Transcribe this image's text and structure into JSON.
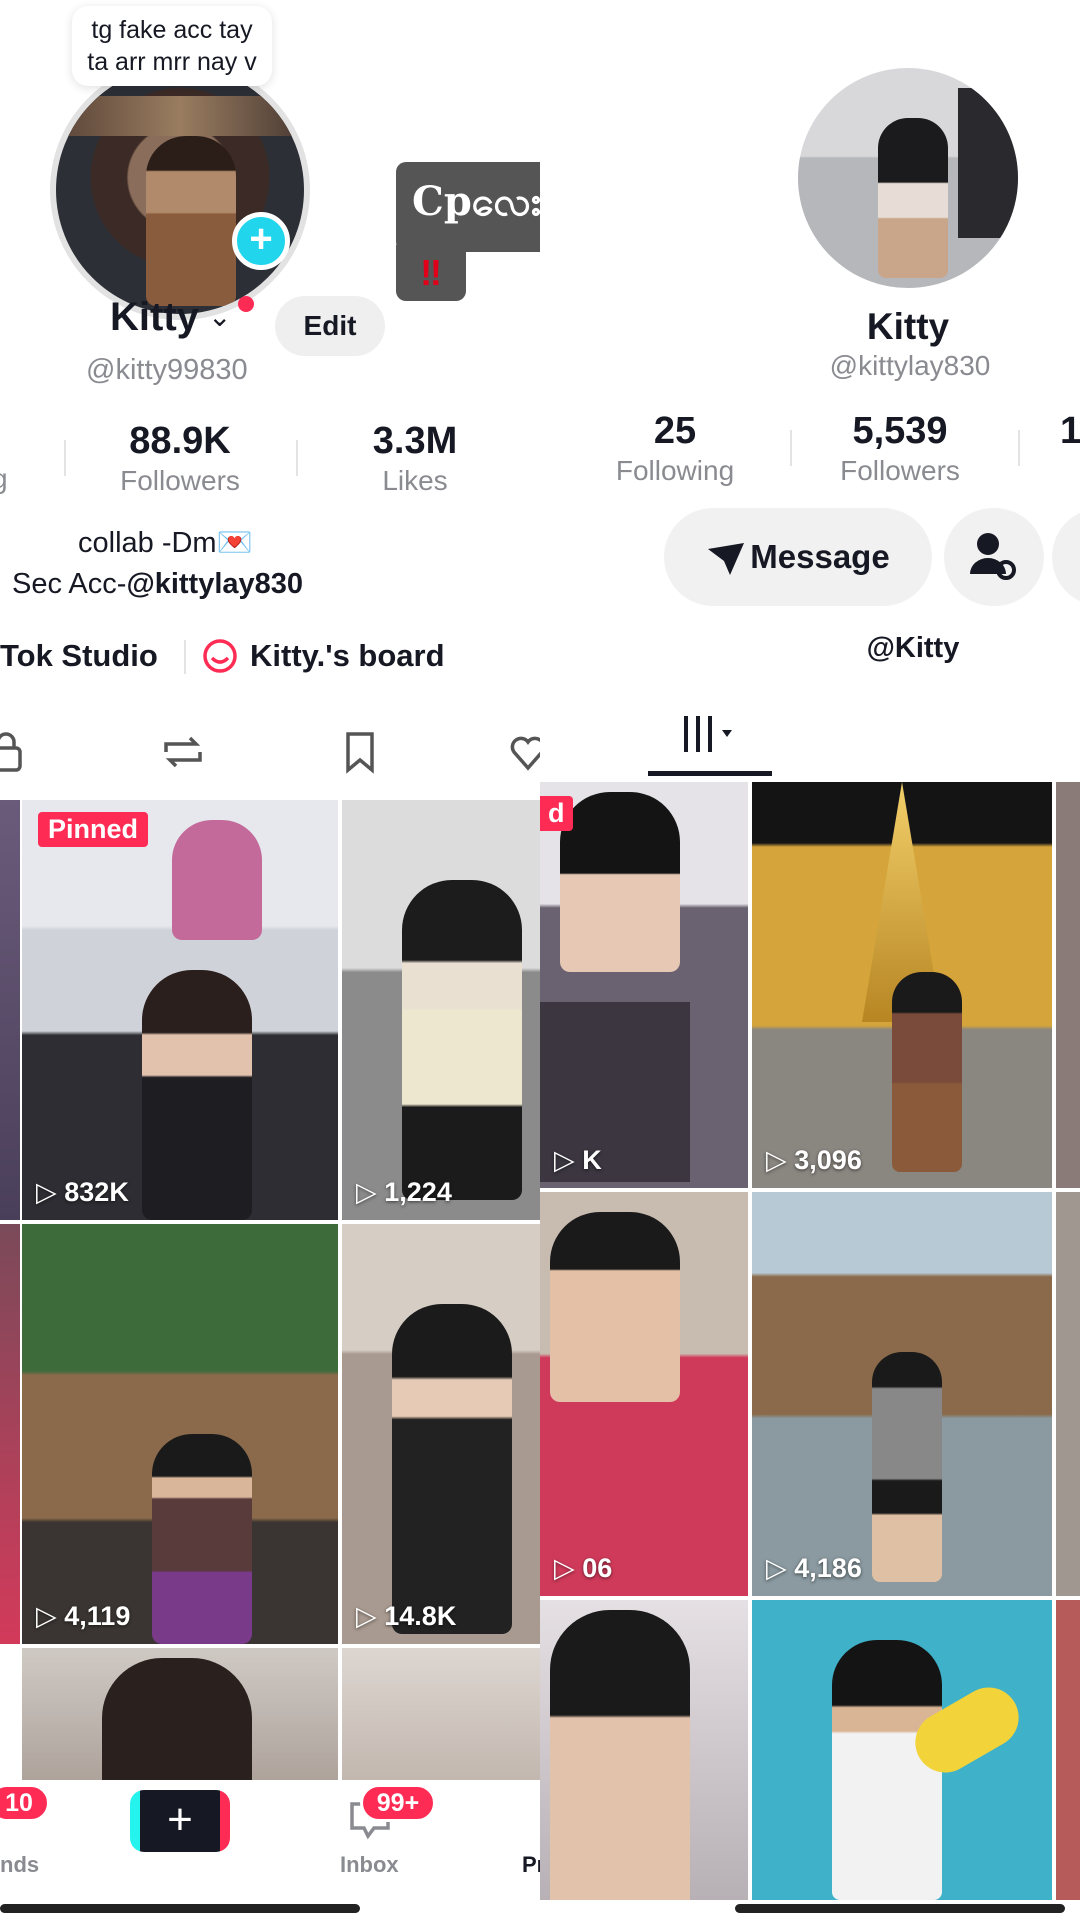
{
  "left_profile": {
    "note": [
      "tg fake acc tay",
      "ta arr mrr nay v"
    ],
    "display_name": "Kitty",
    "chevron": "⌄",
    "edit_label": "Edit",
    "handle": "@kitty99830",
    "stats": [
      {
        "value": "",
        "label": "g"
      },
      {
        "value": "88.9K",
        "label": "Followers"
      },
      {
        "value": "3.3M",
        "label": "Likes"
      }
    ],
    "bio_line1": "collab -Dm💌",
    "bio_line2_prefix": "Sec Acc-",
    "bio_line2_mention": "@kittylay830",
    "links": [
      "Tok Studio",
      "Kitty.'s board"
    ],
    "tabs": [
      "lock-icon",
      "repost-icon",
      "bookmark-icon",
      "heart-icon"
    ],
    "pinned_label": "Pinned",
    "videos": [
      {
        "views": "832K"
      },
      {
        "views": "1,224"
      },
      {
        "views": "4,119"
      },
      {
        "views": "14.8K"
      }
    ],
    "nav": {
      "friends_badge": "10",
      "friends_label": "nds",
      "inbox_badge": "99+",
      "inbox_label": "Inbox",
      "profile_label": "Pr"
    }
  },
  "sticker": {
    "text": "Cpလေးဖတ်ပေးပါ",
    "marks": "‼"
  },
  "right_profile": {
    "display_name": "Kitty",
    "handle": "@kittylay830",
    "stats": [
      {
        "value": "25",
        "label": "Following"
      },
      {
        "value": "5,539",
        "label": "Followers"
      },
      {
        "value": "1",
        "label": ""
      }
    ],
    "message_label": "Message",
    "link_label": "@Kitty",
    "pinned_label": "d",
    "videos": [
      {
        "views": "K"
      },
      {
        "views": "3,096"
      },
      {
        "views": "06"
      },
      {
        "views": "4,186"
      }
    ]
  },
  "colors": {
    "accent_red": "#fe2c55",
    "accent_cyan": "#20d5ec",
    "text_primary": "#161823",
    "text_secondary": "#8a8b91"
  }
}
